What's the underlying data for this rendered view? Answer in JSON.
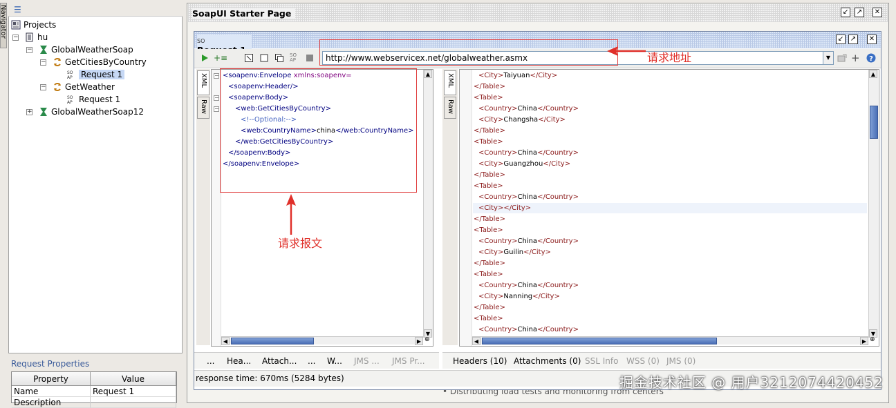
{
  "navigator": {
    "tab_label": "Navigator",
    "tree": [
      {
        "label": "Projects",
        "level": 0,
        "icon": "projects-icon"
      },
      {
        "label": "hu",
        "level": 1,
        "icon": "project-icon"
      },
      {
        "label": "GlobalWeatherSoap",
        "level": 2,
        "icon": "interface-icon"
      },
      {
        "label": "GetCitiesByCountry",
        "level": 3,
        "icon": "operation-icon"
      },
      {
        "label": "Request 1",
        "level": 4,
        "icon": "soap-request-icon",
        "selected": true
      },
      {
        "label": "GetWeather",
        "level": 3,
        "icon": "operation-icon"
      },
      {
        "label": "Request 1",
        "level": 4,
        "icon": "soap-request-icon"
      },
      {
        "label": "GlobalWeatherSoap12",
        "level": 2,
        "icon": "interface-icon"
      }
    ]
  },
  "request_properties": {
    "title": "Request Properties",
    "columns": [
      "Property",
      "Value"
    ],
    "rows": [
      [
        "Name",
        "Request 1"
      ],
      [
        "Description",
        ""
      ]
    ]
  },
  "starter_page": {
    "title": "SoapUI Starter Page"
  },
  "request_window": {
    "title": "Request 1",
    "url": "http://www.webservicex.net/globalweather.asmx",
    "request_tabs": [
      "XML",
      "Raw"
    ],
    "response_tabs": [
      "XML",
      "Raw"
    ],
    "request_xml": [
      "<soapenv:Envelope xmlns:soapenv=\"http://schemas.xmlsoa",
      "<soapenv:Header/>",
      "<soapenv:Body>",
      "<web:GetCitiesByCountry>",
      "<!--Optional:-->",
      "<web:CountryName>china</web:CountryName>",
      "</web:GetCitiesByCountry>",
      "</soapenv:Body>",
      "</soapenv:Envelope>"
    ],
    "response_xml": [
      "<City>Taiyuan</City>",
      "</Table>",
      "<Table>",
      "<Country>China</Country>",
      "<City>Changsha</City>",
      "</Table>",
      "<Table>",
      "<Country>China</Country>",
      "<City>Guangzhou</City>",
      "</Table>",
      "<Table>",
      "<Country>China</Country>",
      "<City></City>",
      "</Table>",
      "<Table>",
      "<Country>China</Country>",
      "<City>Guilin</City>",
      "</Table>",
      "<Table>",
      "<Country>China</Country>",
      "<City>Nanning</City>",
      "</Table>",
      "<Table>",
      "<Country>China</Country>"
    ],
    "request_bottom_tabs": [
      "...",
      "Hea...",
      "Attach...",
      "...",
      "W...",
      "JMS ...",
      "JMS Pr..."
    ],
    "response_bottom_tabs": [
      "Headers (10)",
      "Attachments (0)",
      "SSL Info",
      "WSS (0)",
      "JMS (0)"
    ],
    "status": "response time: 670ms (5284 bytes)"
  },
  "annotations": {
    "url_label": "请求地址",
    "body_label": "请求报文",
    "color": "#e0302a"
  },
  "watermark": "掘金技术社区 @ 用户3212074420452",
  "bottom_text": "• Distributing load tests and monitoring from centers"
}
